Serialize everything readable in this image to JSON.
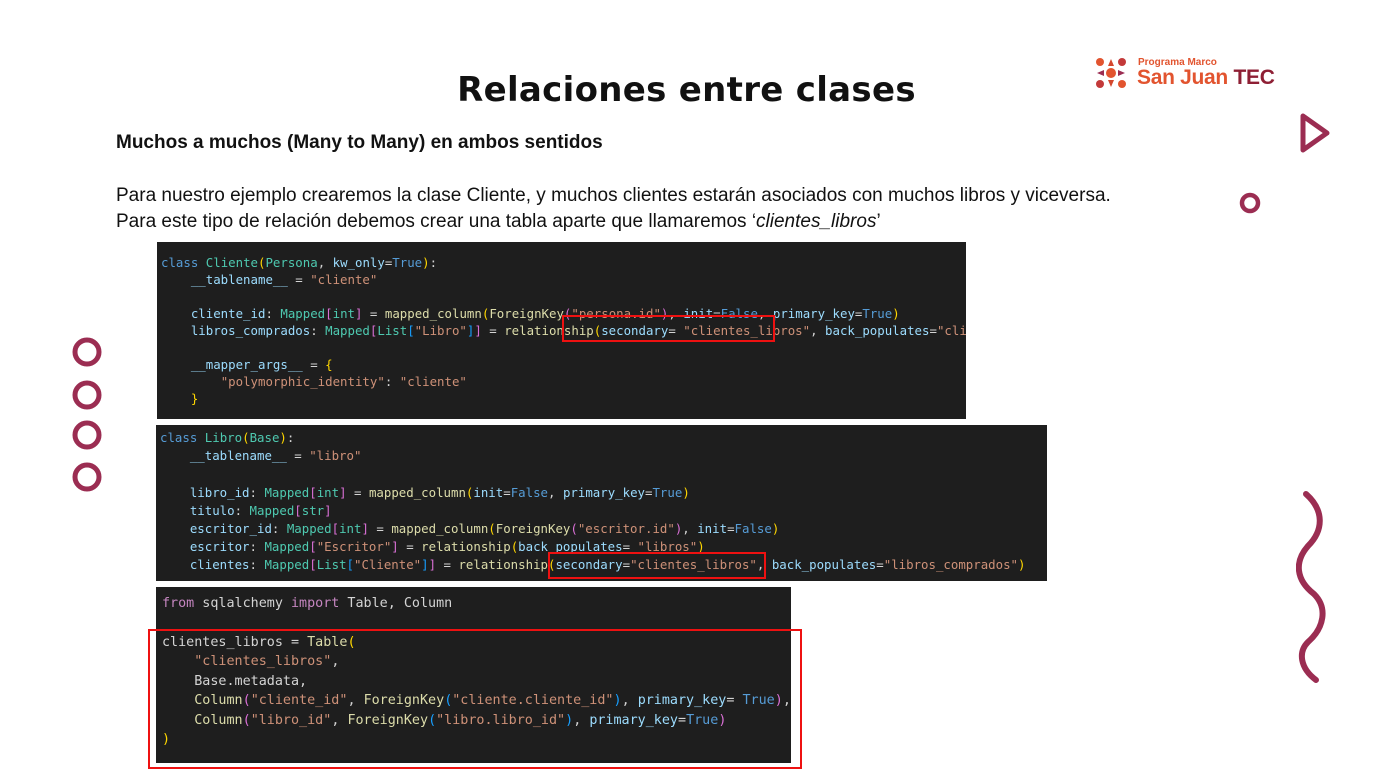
{
  "slide": {
    "title": "Relaciones entre clases",
    "subtitle": "Muchos a muchos (Many to Many) en ambos sentidos",
    "paragraph_line1": "Para nuestro ejemplo crearemos la clase Cliente, y muchos clientes estarán asociados con muchos libros y viceversa.",
    "paragraph_line2_prefix": "Para este tipo de relación debemos crear una tabla aparte que llamaremos ‘",
    "paragraph_line2_italic": "clientes_libros",
    "paragraph_line2_suffix": "’"
  },
  "logo": {
    "small_text": "Programa Marco",
    "name_part1": "San Juan ",
    "name_part2": "TEC"
  },
  "code_blocks": [
    {
      "name": "cliente-code",
      "lines": [
        "class Cliente(Persona, kw_only=True):",
        "    __tablename__ = \"cliente\"",
        "",
        "    cliente_id: Mapped[int] = mapped_column(ForeignKey(\"persona.id\"), init=False, primary_key=True)",
        "    libros_comprados: Mapped[List[\"Libro\"]] = relationship(secondary= \"clientes_libros\", back_populates=\"clientes\")",
        "",
        "    __mapper_args__ = {",
        "        \"polymorphic_identity\": \"cliente\"",
        "    }"
      ]
    },
    {
      "name": "libro-code",
      "lines": [
        "class Libro(Base):",
        "    __tablename__ = \"libro\"",
        "",
        "    libro_id: Mapped[int] = mapped_column(init=False, primary_key=True)",
        "    titulo: Mapped[str]",
        "    escritor_id: Mapped[int] = mapped_column(ForeignKey(\"escritor.id\"), init=False)",
        "    escritor: Mapped[\"Escritor\"] = relationship(back_populates= \"libros\")",
        "    clientes: Mapped[List[\"Cliente\"]] = relationship(secondary=\"clientes_libros\", back_populates=\"libros_comprados\")"
      ]
    },
    {
      "name": "table-code",
      "lines": [
        "from sqlalchemy import Table, Column",
        "",
        "clientes_libros = Table(",
        "    \"clientes_libros\",",
        "    Base.metadata,",
        "    Column(\"cliente_id\", ForeignKey(\"cliente.cliente_id\"), primary_key= True),",
        "    Column(\"libro_id\", ForeignKey(\"libro.libro_id\"), primary_key=True)",
        ")"
      ]
    }
  ],
  "colors": {
    "accent_maroon": "#9b2d52",
    "logo_orange": "#e2542f",
    "highlight_red": "#ee1111",
    "code_background": "#1e1e1e"
  }
}
